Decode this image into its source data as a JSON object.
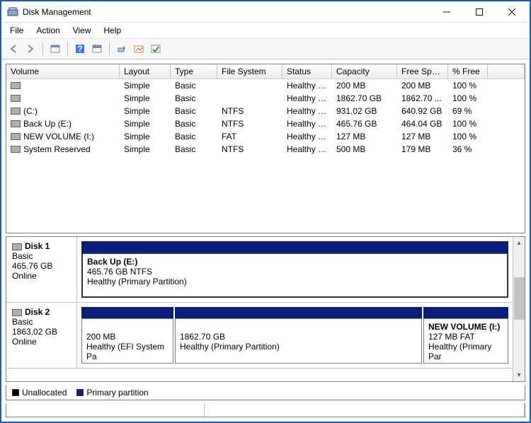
{
  "window": {
    "title": "Disk Management"
  },
  "menu": [
    "File",
    "Action",
    "View",
    "Help"
  ],
  "columns": [
    "Volume",
    "Layout",
    "Type",
    "File System",
    "Status",
    "Capacity",
    "Free Spa...",
    "% Free"
  ],
  "volumes": [
    {
      "name": "",
      "layout": "Simple",
      "type": "Basic",
      "fs": "",
      "status": "Healthy (E...",
      "capacity": "200 MB",
      "free": "200 MB",
      "pct": "100 %"
    },
    {
      "name": "",
      "layout": "Simple",
      "type": "Basic",
      "fs": "",
      "status": "Healthy (P...",
      "capacity": "1862.70 GB",
      "free": "1862.70 ...",
      "pct": "100 %"
    },
    {
      "name": "(C:)",
      "layout": "Simple",
      "type": "Basic",
      "fs": "NTFS",
      "status": "Healthy (B...",
      "capacity": "931.02 GB",
      "free": "640.92 GB",
      "pct": "69 %"
    },
    {
      "name": "Back Up (E:)",
      "layout": "Simple",
      "type": "Basic",
      "fs": "NTFS",
      "status": "Healthy (P...",
      "capacity": "465.76 GB",
      "free": "464.04 GB",
      "pct": "100 %"
    },
    {
      "name": "NEW VOLUME (I:)",
      "layout": "Simple",
      "type": "Basic",
      "fs": "FAT",
      "status": "Healthy (P...",
      "capacity": "127 MB",
      "free": "127 MB",
      "pct": "100 %"
    },
    {
      "name": "System Reserved",
      "layout": "Simple",
      "type": "Basic",
      "fs": "NTFS",
      "status": "Healthy (S...",
      "capacity": "500 MB",
      "free": "179 MB",
      "pct": "36 %"
    }
  ],
  "disks": {
    "d1": {
      "name": "Disk 1",
      "type": "Basic",
      "size": "465.76 GB",
      "state": "Online",
      "p1": {
        "name": "Back Up  (E:)",
        "line2": "465.76 GB NTFS",
        "line3": "Healthy (Primary Partition)"
      }
    },
    "d2": {
      "name": "Disk 2",
      "type": "Basic",
      "size": "1863.02 GB",
      "state": "Online",
      "p1": {
        "line2": "200 MB",
        "line3": "Healthy (EFI System Pa"
      },
      "p2": {
        "line2": "1862.70 GB",
        "line3": "Healthy (Primary Partition)"
      },
      "p3": {
        "name": "NEW VOLUME  (I:)",
        "line2": "127 MB FAT",
        "line3": "Healthy (Primary Par"
      }
    }
  },
  "legend": {
    "unalloc": "Unallocated",
    "primary": "Primary partition"
  }
}
